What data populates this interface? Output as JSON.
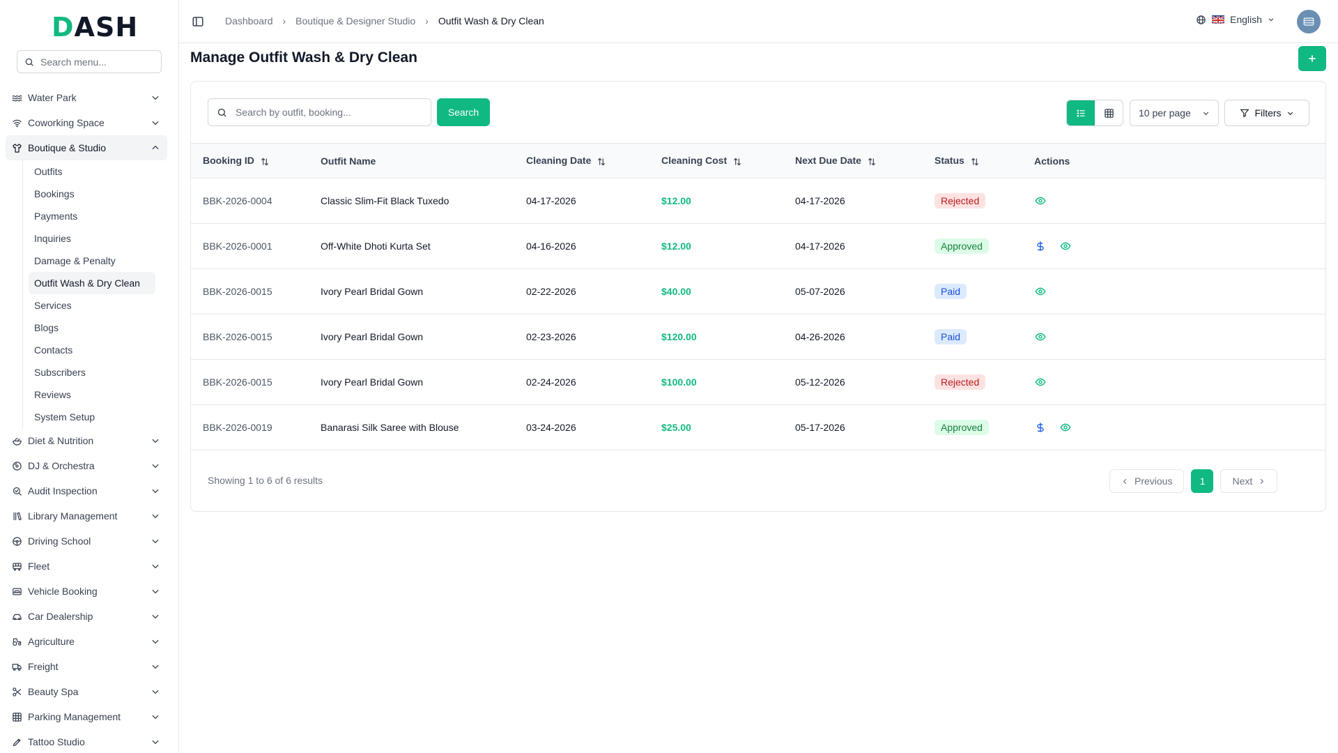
{
  "brand": {
    "logo_first": "D",
    "logo_rest": "ASH",
    "accent": "#10b981"
  },
  "sidebar": {
    "search_placeholder": "Search menu...",
    "items_top": [
      {
        "label": "Water Park",
        "icon": "waves-icon"
      },
      {
        "label": "Coworking Space",
        "icon": "wifi-icon"
      }
    ],
    "active_group": {
      "label": "Boutique & Studio",
      "icon": "shirt-icon"
    },
    "subitems": [
      "Outfits",
      "Bookings",
      "Payments",
      "Inquiries",
      "Damage & Penalty",
      "Outfit Wash & Dry Clean",
      "Services",
      "Blogs",
      "Contacts",
      "Subscribers",
      "Reviews",
      "System Setup"
    ],
    "items_bottom": [
      {
        "label": "Diet & Nutrition",
        "icon": "salad-icon"
      },
      {
        "label": "DJ & Orchestra",
        "icon": "disc-icon"
      },
      {
        "label": "Audit Inspection",
        "icon": "search-check-icon"
      },
      {
        "label": "Library Management",
        "icon": "library-icon"
      },
      {
        "label": "Driving School",
        "icon": "steering-wheel-icon"
      },
      {
        "label": "Fleet",
        "icon": "bus-icon"
      },
      {
        "label": "Vehicle Booking",
        "icon": "car-ticket-icon"
      },
      {
        "label": "Car Dealership",
        "icon": "car-icon"
      },
      {
        "label": "Agriculture",
        "icon": "tractor-icon"
      },
      {
        "label": "Freight",
        "icon": "truck-icon"
      },
      {
        "label": "Beauty Spa",
        "icon": "scissors-icon"
      },
      {
        "label": "Parking Management",
        "icon": "grid-icon"
      },
      {
        "label": "Tattoo Studio",
        "icon": "pen-icon"
      }
    ]
  },
  "header": {
    "breadcrumbs": [
      "Dashboard",
      "Boutique & Designer Studio",
      "Outfit Wash & Dry Clean"
    ],
    "language": "English"
  },
  "page": {
    "title": "Manage Outfit Wash & Dry Clean",
    "search_placeholder": "Search by outfit, booking...",
    "search_button": "Search",
    "per_page": "10 per page",
    "filters_label": "Filters"
  },
  "table": {
    "columns": [
      "Booking ID",
      "Outfit Name",
      "Cleaning Date",
      "Cleaning Cost",
      "Next Due Date",
      "Status",
      "Actions"
    ],
    "rows": [
      {
        "booking_id": "BBK-2026-0004",
        "outfit": "Classic Slim-Fit Black Tuxedo",
        "cleaning_date": "04-17-2026",
        "cost": "$12.00",
        "next_due": "04-17-2026",
        "status": "Rejected",
        "status_kind": "rejected",
        "has_pay": false
      },
      {
        "booking_id": "BBK-2026-0001",
        "outfit": "Off-White Dhoti Kurta Set",
        "cleaning_date": "04-16-2026",
        "cost": "$12.00",
        "next_due": "04-17-2026",
        "status": "Approved",
        "status_kind": "approved",
        "has_pay": true
      },
      {
        "booking_id": "BBK-2026-0015",
        "outfit": "Ivory Pearl Bridal Gown",
        "cleaning_date": "02-22-2026",
        "cost": "$40.00",
        "next_due": "05-07-2026",
        "status": "Paid",
        "status_kind": "paid",
        "has_pay": false
      },
      {
        "booking_id": "BBK-2026-0015",
        "outfit": "Ivory Pearl Bridal Gown",
        "cleaning_date": "02-23-2026",
        "cost": "$120.00",
        "next_due": "04-26-2026",
        "status": "Paid",
        "status_kind": "paid",
        "has_pay": false
      },
      {
        "booking_id": "BBK-2026-0015",
        "outfit": "Ivory Pearl Bridal Gown",
        "cleaning_date": "02-24-2026",
        "cost": "$100.00",
        "next_due": "05-12-2026",
        "status": "Rejected",
        "status_kind": "rejected",
        "has_pay": false
      },
      {
        "booking_id": "BBK-2026-0019",
        "outfit": "Banarasi Silk Saree with Blouse",
        "cleaning_date": "03-24-2026",
        "cost": "$25.00",
        "next_due": "05-17-2026",
        "status": "Approved",
        "status_kind": "approved",
        "has_pay": true
      }
    ]
  },
  "pagination": {
    "summary": "Showing 1 to 6 of 6 results",
    "previous": "Previous",
    "current": "1",
    "next": "Next"
  }
}
